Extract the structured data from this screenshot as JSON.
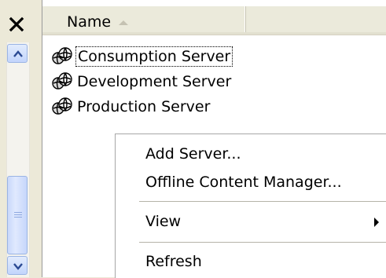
{
  "window": {
    "close_glyph": "✕"
  },
  "list": {
    "column_header": "Name",
    "sort_direction": "ascending",
    "items": [
      {
        "label": "Consumption Server",
        "icon": "server-icon",
        "focused": true
      },
      {
        "label": "Development Server",
        "icon": "server-icon",
        "focused": false
      },
      {
        "label": "Production Server",
        "icon": "server-icon",
        "focused": false
      }
    ]
  },
  "context_menu": {
    "items": [
      {
        "label": "Add Server..."
      },
      {
        "label": "Offline Content Manager..."
      },
      {
        "label": "View",
        "has_submenu": true
      },
      {
        "label": "Refresh"
      }
    ]
  },
  "colors": {
    "scrollbar_accent": "#c3d5fc",
    "header_bg": "#ebeadb",
    "panel_bg": "#ece9d8"
  }
}
